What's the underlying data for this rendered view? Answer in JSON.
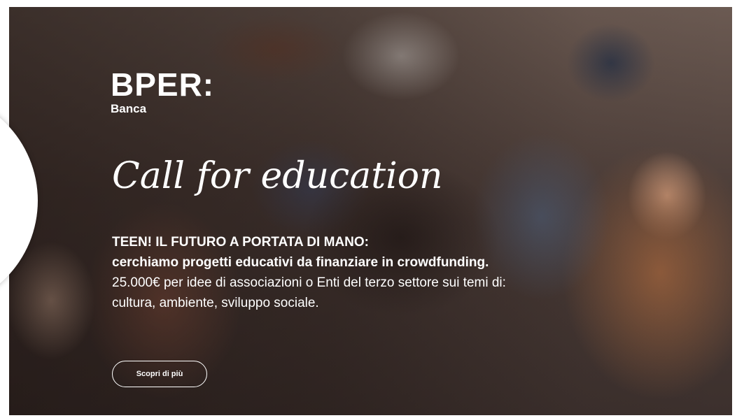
{
  "logo": {
    "brand": "BPER:",
    "sub": "Banca"
  },
  "hero": {
    "script_title": "Call for education",
    "headline_1": "TEEN! IL FUTURO A PORTATA DI MANO:",
    "headline_2": "cerchiamo progetti educativi da finanziare in crowdfunding.",
    "body_1": "25.000€ per idee di associazioni o Enti del terzo settore sui temi di:",
    "body_2": "cultura, ambiente, sviluppo sociale.",
    "cta_label": "Scopri di più"
  },
  "colors": {
    "text": "#ffffff",
    "button_border": "#ffffff"
  }
}
